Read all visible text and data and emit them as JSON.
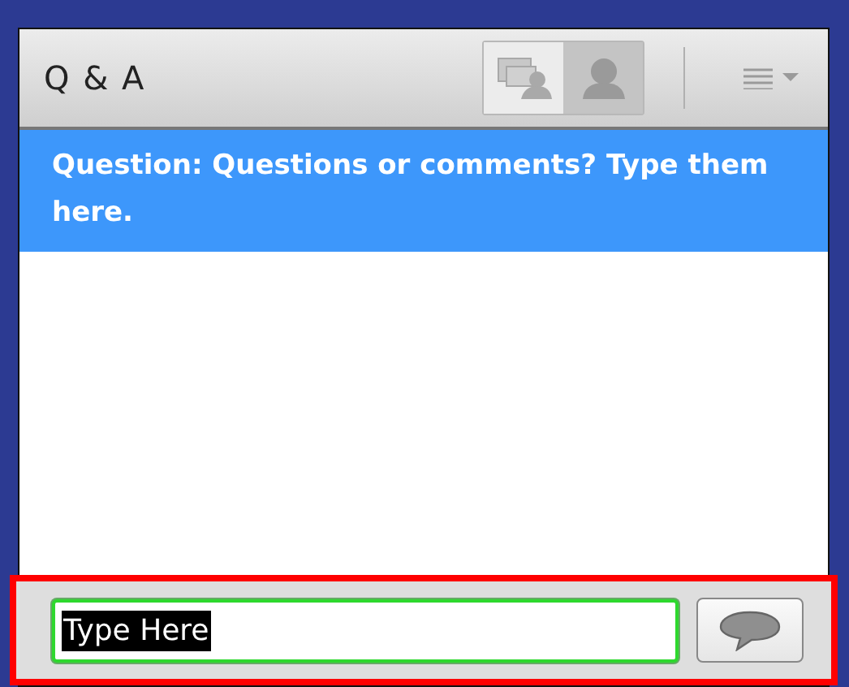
{
  "panel": {
    "title": "Q & A"
  },
  "view_toggles": [
    {
      "kind": "presenter",
      "selected": false
    },
    {
      "kind": "participant",
      "selected": true
    }
  ],
  "question": {
    "text": "Question: Questions or comments? Type them here."
  },
  "composer": {
    "value": "Type Here",
    "value_selected": true,
    "focused": true,
    "highlighted": true
  }
}
